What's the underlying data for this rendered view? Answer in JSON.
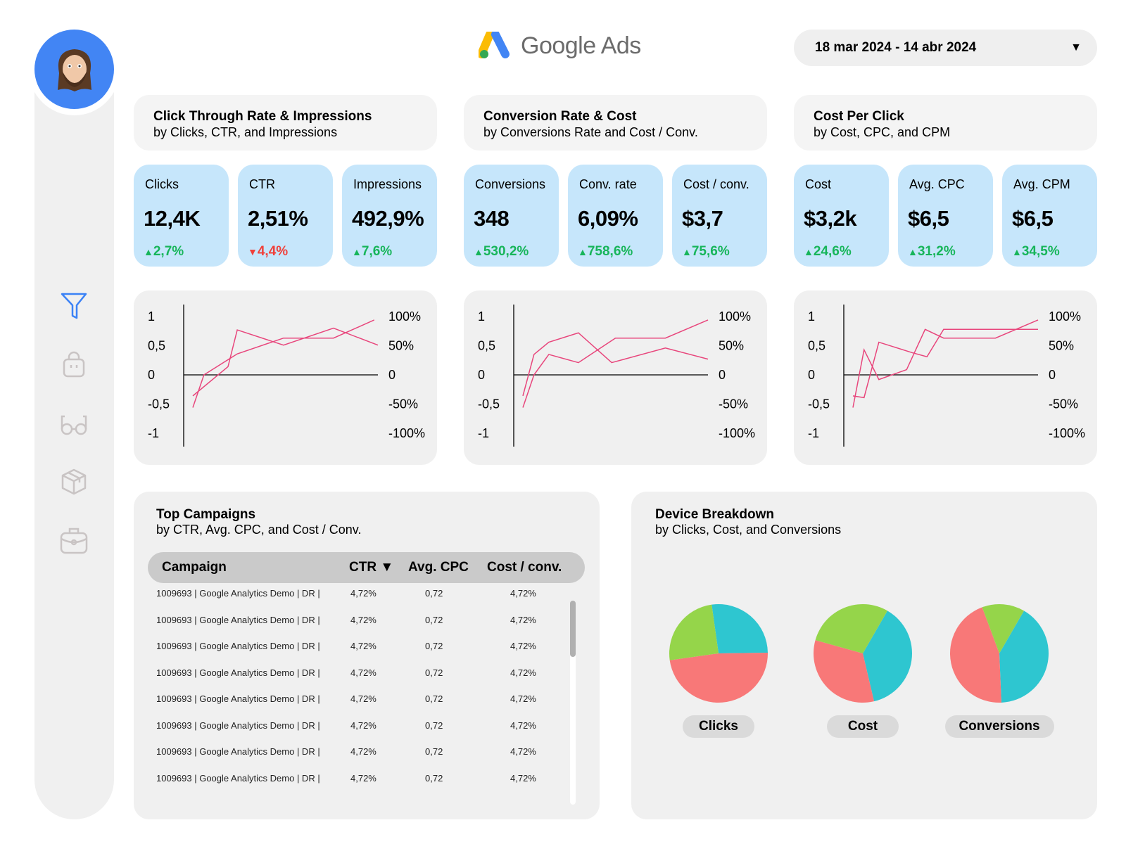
{
  "app": {
    "logo_text": "Google Ads"
  },
  "date_range": {
    "value": "18 mar 2024 - 14 abr 2024",
    "arrow": "▼"
  },
  "sidebar": {
    "items": [
      {
        "icon": "filter-icon",
        "active": true
      },
      {
        "icon": "shopping-bag-icon"
      },
      {
        "icon": "glasses-icon"
      },
      {
        "icon": "package-icon"
      },
      {
        "icon": "briefcase-icon"
      }
    ]
  },
  "colors": {
    "accent": "#4285f4",
    "kpi_bg": "#c6e6fb",
    "up": "#17b55a",
    "down": "#f0403a",
    "line": "#e8467c",
    "pie_green": "#95d54a",
    "pie_teal": "#2ec6d0",
    "pie_red": "#f87878"
  },
  "sections": [
    {
      "title": "Click Through Rate & Impressions",
      "subtitle": "by Clicks, CTR, and Impressions",
      "kpis": [
        {
          "label": "Clicks",
          "value": "12,4K",
          "delta": "2,7%",
          "dir": "up"
        },
        {
          "label": "CTR",
          "value": "2,51%",
          "delta": "4,4%",
          "dir": "down"
        },
        {
          "label": "Impressions",
          "value": "492,9%",
          "delta": "7,6%",
          "dir": "up"
        }
      ]
    },
    {
      "title": "Conversion Rate & Cost",
      "subtitle": "by Conversions Rate and Cost / Conv.",
      "kpis": [
        {
          "label": "Conversions",
          "value": "348",
          "delta": "530,2%",
          "dir": "up"
        },
        {
          "label": "Conv. rate",
          "value": "6,09%",
          "delta": "758,6%",
          "dir": "up"
        },
        {
          "label": "Cost / conv.",
          "value": "$3,7",
          "delta": "75,6%",
          "dir": "up"
        }
      ]
    },
    {
      "title": "Cost Per Click",
      "subtitle": "by Cost, CPC, and CPM",
      "kpis": [
        {
          "label": "Cost",
          "value": "$3,2k",
          "delta": "24,6%",
          "dir": "up"
        },
        {
          "label": "Avg. CPC",
          "value": "$6,5",
          "delta": "31,2%",
          "dir": "up"
        },
        {
          "label": "Avg. CPM",
          "value": "$6,5",
          "delta": "34,5%",
          "dir": "up"
        }
      ]
    }
  ],
  "chart_data": [
    {
      "type": "line",
      "ylim": [
        -1,
        1
      ],
      "y2lim": [
        -100,
        100
      ],
      "left_ticks": [
        "1",
        "0,5",
        "0",
        "-0,5",
        "-1"
      ],
      "right_ticks": [
        "100%",
        "50%",
        "0",
        "-50%",
        "-100%"
      ],
      "series": [
        {
          "axis": "left",
          "points": [
            [
              0,
              -0.56
            ],
            [
              0.6,
              0
            ],
            [
              2.4,
              0.36
            ],
            [
              4.9,
              0.63
            ],
            [
              7.6,
              0.63
            ],
            [
              9.8,
              0.94
            ]
          ]
        },
        {
          "axis": "right",
          "points": [
            [
              0,
              -36
            ],
            [
              1.9,
              14
            ],
            [
              2.4,
              77
            ],
            [
              4.9,
              51
            ],
            [
              7.6,
              80
            ],
            [
              10,
              51
            ]
          ]
        }
      ]
    },
    {
      "type": "line",
      "ylim": [
        -1,
        1
      ],
      "y2lim": [
        -100,
        100
      ],
      "left_ticks": [
        "1",
        "0,5",
        "0",
        "-0,5",
        "-1"
      ],
      "right_ticks": [
        "100%",
        "50%",
        "0",
        "-50%",
        "-100%"
      ],
      "series": [
        {
          "axis": "left",
          "points": [
            [
              0,
              -0.56
            ],
            [
              0.6,
              0
            ],
            [
              1.4,
              0.35
            ],
            [
              3,
              0.21
            ],
            [
              5,
              0.63
            ],
            [
              7.7,
              0.63
            ],
            [
              10,
              0.94
            ]
          ]
        },
        {
          "axis": "right",
          "points": [
            [
              0,
              -36
            ],
            [
              0.6,
              35
            ],
            [
              1.4,
              56
            ],
            [
              3,
              72
            ],
            [
              4.8,
              21
            ],
            [
              7.7,
              46
            ],
            [
              10,
              27
            ]
          ]
        }
      ]
    },
    {
      "type": "line",
      "ylim": [
        -1,
        1
      ],
      "y2lim": [
        -100,
        100
      ],
      "left_ticks": [
        "1",
        "0,5",
        "0",
        "-0,5",
        "-1"
      ],
      "right_ticks": [
        "100%",
        "50%",
        "0",
        "-50%",
        "-100%"
      ],
      "series": [
        {
          "axis": "left",
          "points": [
            [
              0,
              -0.56
            ],
            [
              0.6,
              0.43
            ],
            [
              1.4,
              -0.08
            ],
            [
              2.9,
              0.09
            ],
            [
              3.9,
              0.78
            ],
            [
              4.9,
              0.63
            ],
            [
              7.7,
              0.63
            ],
            [
              10,
              0.94
            ]
          ]
        },
        {
          "axis": "right",
          "points": [
            [
              0,
              -36
            ],
            [
              0.6,
              -39
            ],
            [
              1.4,
              56
            ],
            [
              3.2,
              38
            ],
            [
              4,
              31
            ],
            [
              4.9,
              78
            ],
            [
              10,
              78
            ]
          ]
        }
      ]
    }
  ],
  "campaigns": {
    "title": "Top Campaigns",
    "subtitle": "by CTR, Avg. CPC, and Cost / Conv.",
    "columns": [
      "Campaign",
      "CTR ▼",
      "Avg. CPC",
      "Cost / conv."
    ],
    "rows": [
      [
        "1009693 | Google Analytics Demo | DR |",
        "4,72%",
        "0,72",
        "4,72%"
      ],
      [
        "1009693 | Google Analytics Demo | DR |",
        "4,72%",
        "0,72",
        "4,72%"
      ],
      [
        "1009693 | Google Analytics Demo | DR |",
        "4,72%",
        "0,72",
        "4,72%"
      ],
      [
        "1009693 | Google Analytics Demo | DR |",
        "4,72%",
        "0,72",
        "4,72%"
      ],
      [
        "1009693 | Google Analytics Demo | DR |",
        "4,72%",
        "0,72",
        "4,72%"
      ],
      [
        "1009693 | Google Analytics Demo | DR |",
        "4,72%",
        "0,72",
        "4,72%"
      ],
      [
        "1009693 | Google Analytics Demo | DR |",
        "4,72%",
        "0,72",
        "4,72%"
      ],
      [
        "1009693 | Google Analytics Demo | DR |",
        "4,72%",
        "0,72",
        "4,72%"
      ]
    ]
  },
  "devices": {
    "title": "Device Breakdown",
    "subtitle": "by Clicks, Cost, and Conversions",
    "pies": [
      {
        "label": "Clicks",
        "slices": [
          {
            "color": "#2ec6d0",
            "value": 27
          },
          {
            "color": "#f87878",
            "value": 48
          },
          {
            "color": "#95d54a",
            "value": 25
          }
        ],
        "start_deg": -8
      },
      {
        "label": "Cost",
        "slices": [
          {
            "color": "#2ec6d0",
            "value": 38
          },
          {
            "color": "#f87878",
            "value": 33
          },
          {
            "color": "#95d54a",
            "value": 29
          }
        ],
        "start_deg": 30
      },
      {
        "label": "Conversions",
        "slices": [
          {
            "color": "#2ec6d0",
            "value": 41
          },
          {
            "color": "#f87878",
            "value": 45
          },
          {
            "color": "#95d54a",
            "value": 14
          }
        ],
        "start_deg": 30
      }
    ]
  }
}
